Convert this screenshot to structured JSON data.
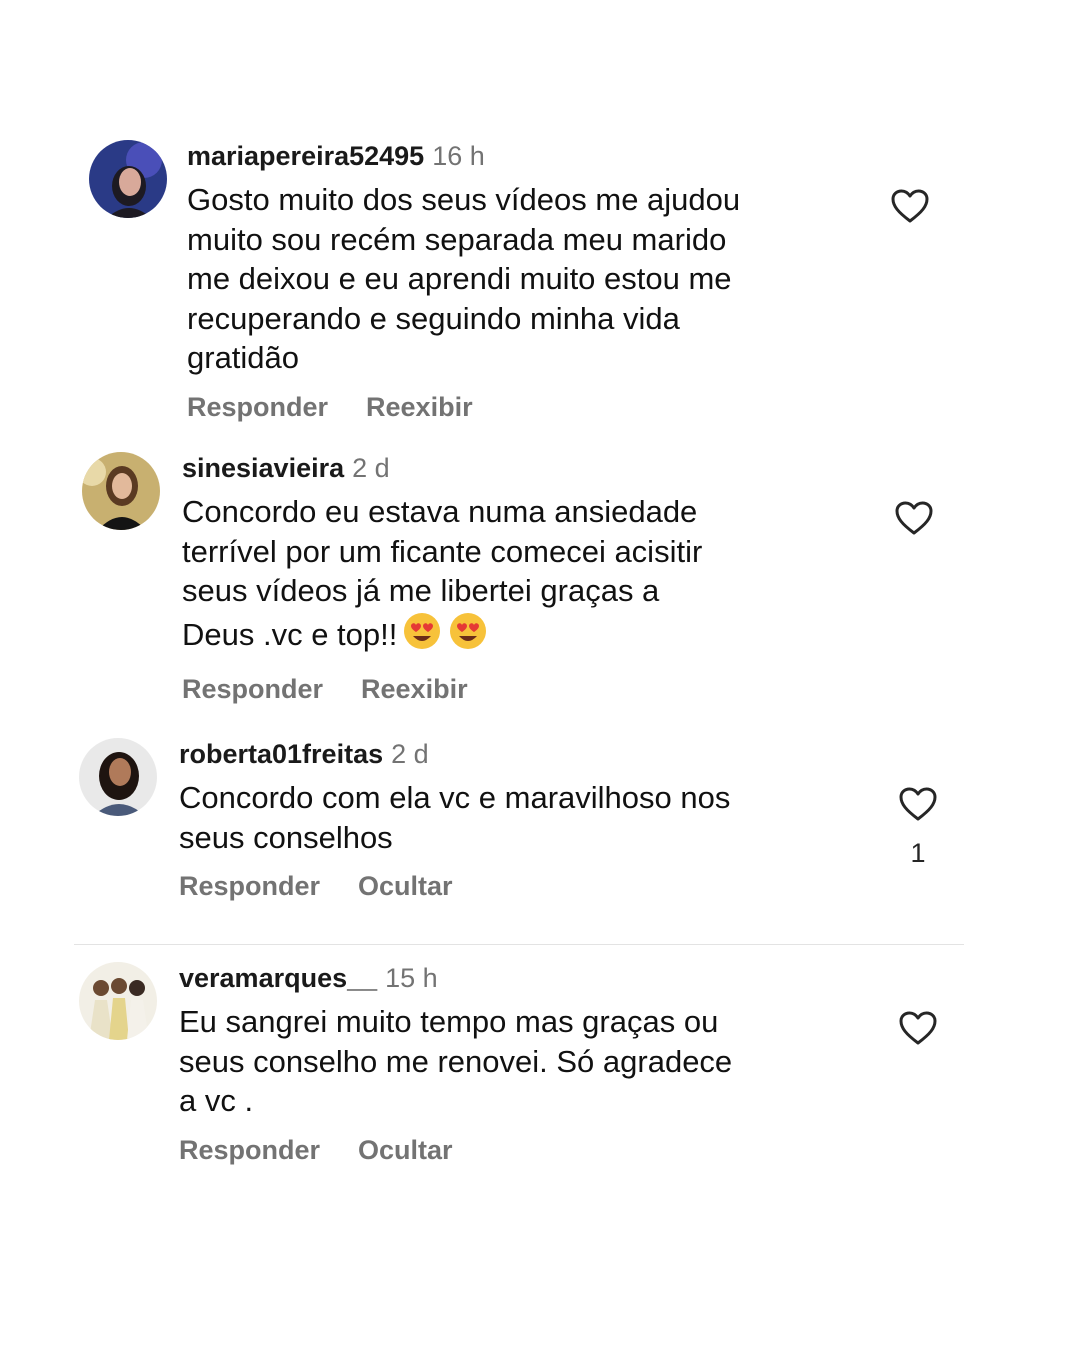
{
  "comments": [
    {
      "username": "mariapereira52495",
      "time": "16 h",
      "text": "Gosto muito dos seus vídeos me ajudou\nmuito sou recém separada meu marido\nme deixou e eu aprendi muito estou me\nrecuperando e seguindo minha vida\ngratidão",
      "reply_label": "Responder",
      "second_action": "Reexibir",
      "like_count": "",
      "avatar_colors": [
        "#2a3a86",
        "#d8a99a"
      ]
    },
    {
      "username": "sinesiavieira",
      "time": "2 d",
      "text": "Concordo eu estava numa ansiedade\nterrível por um ficante comecei acisitir\nseus vídeos já me libertei graças a\nDeus .vc e top!!",
      "emojis": [
        "smiling-face-with-heart-eyes",
        "smiling-face-with-heart-eyes"
      ],
      "reply_label": "Responder",
      "second_action": "Reexibir",
      "like_count": "",
      "avatar_colors": [
        "#c8b070",
        "#e2b99b"
      ]
    },
    {
      "username": "roberta01freitas",
      "time": "2 d",
      "text": "Concordo com ela vc e maravilhoso nos\nseus conselhos",
      "reply_label": "Responder",
      "second_action": "Ocultar",
      "like_count": "1",
      "avatar_colors": [
        "#e9e9e9",
        "#b07a5a"
      ]
    },
    {
      "username": "veramarques__",
      "time": "15 h",
      "text": "Eu sangrei muito tempo mas graças ou\nseus conselho me renovei.  Só agradece\na vc .",
      "reply_label": "Responder",
      "second_action": "Ocultar",
      "like_count": "",
      "avatar_colors": [
        "#f2efe6",
        "#e4d48c"
      ]
    }
  ],
  "icons": {
    "like": "heart-outline-icon",
    "emoji": "smiling-face-with-heart-eyes"
  },
  "colors": {
    "text": "#111111",
    "secondary": "#737373",
    "divider": "#e3e3e3"
  }
}
